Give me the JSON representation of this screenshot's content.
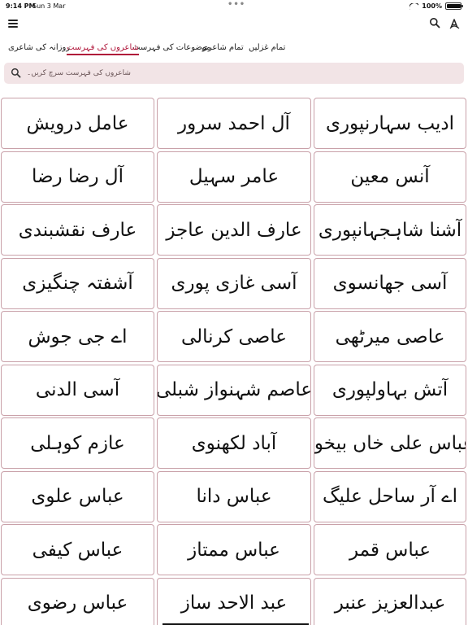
{
  "status": {
    "time": "9:14 PM",
    "date": "Sun 3 Mar",
    "dots": "•••",
    "battery_text": "100%",
    "battery_level": 1.0
  },
  "tabs": [
    {
      "label": "تمام غزلیں"
    },
    {
      "label": "تمام شاعری"
    },
    {
      "label": "موضوعات کی فہرست"
    },
    {
      "label": "شاعروں کی فہرست"
    },
    {
      "label": "روزانہ کی شاعری"
    }
  ],
  "search": {
    "placeholder": "شاعروں کی فہرست سرچ کریں۔"
  },
  "poets": [
    [
      "ادیب سہارنپوری",
      "آل احمد سرور",
      "عامل درویش"
    ],
    [
      "آنس معین",
      "عامر سہیل",
      "آل رضا رضا"
    ],
    [
      "آشنا شاہجہانپوری",
      "عارف الدین عاجز",
      "عارف نقشبندی"
    ],
    [
      "آسی جھانسوی",
      "آسی غازی پوری",
      "آشفتہ چنگیزی"
    ],
    [
      "عاصی میرٹھی",
      "عاصی کرنالی",
      "اے جی جوش"
    ],
    [
      "آتش بہاولپوری",
      "عاصم شہنواز شبلی",
      "آسی الدنی"
    ],
    [
      "عباس علی خاں بیخود",
      "آباد لکھنوی",
      "عازم کوہلی"
    ],
    [
      "اے آر ساحل علیگ",
      "عباس دانا",
      "عباس علوی"
    ],
    [
      "عباس قمر",
      "عباس ممتاز",
      "عباس کیفی"
    ],
    [
      "عبدالعزیز عنبر",
      "عبد الاحد ساز",
      "عباس رضوی"
    ]
  ]
}
